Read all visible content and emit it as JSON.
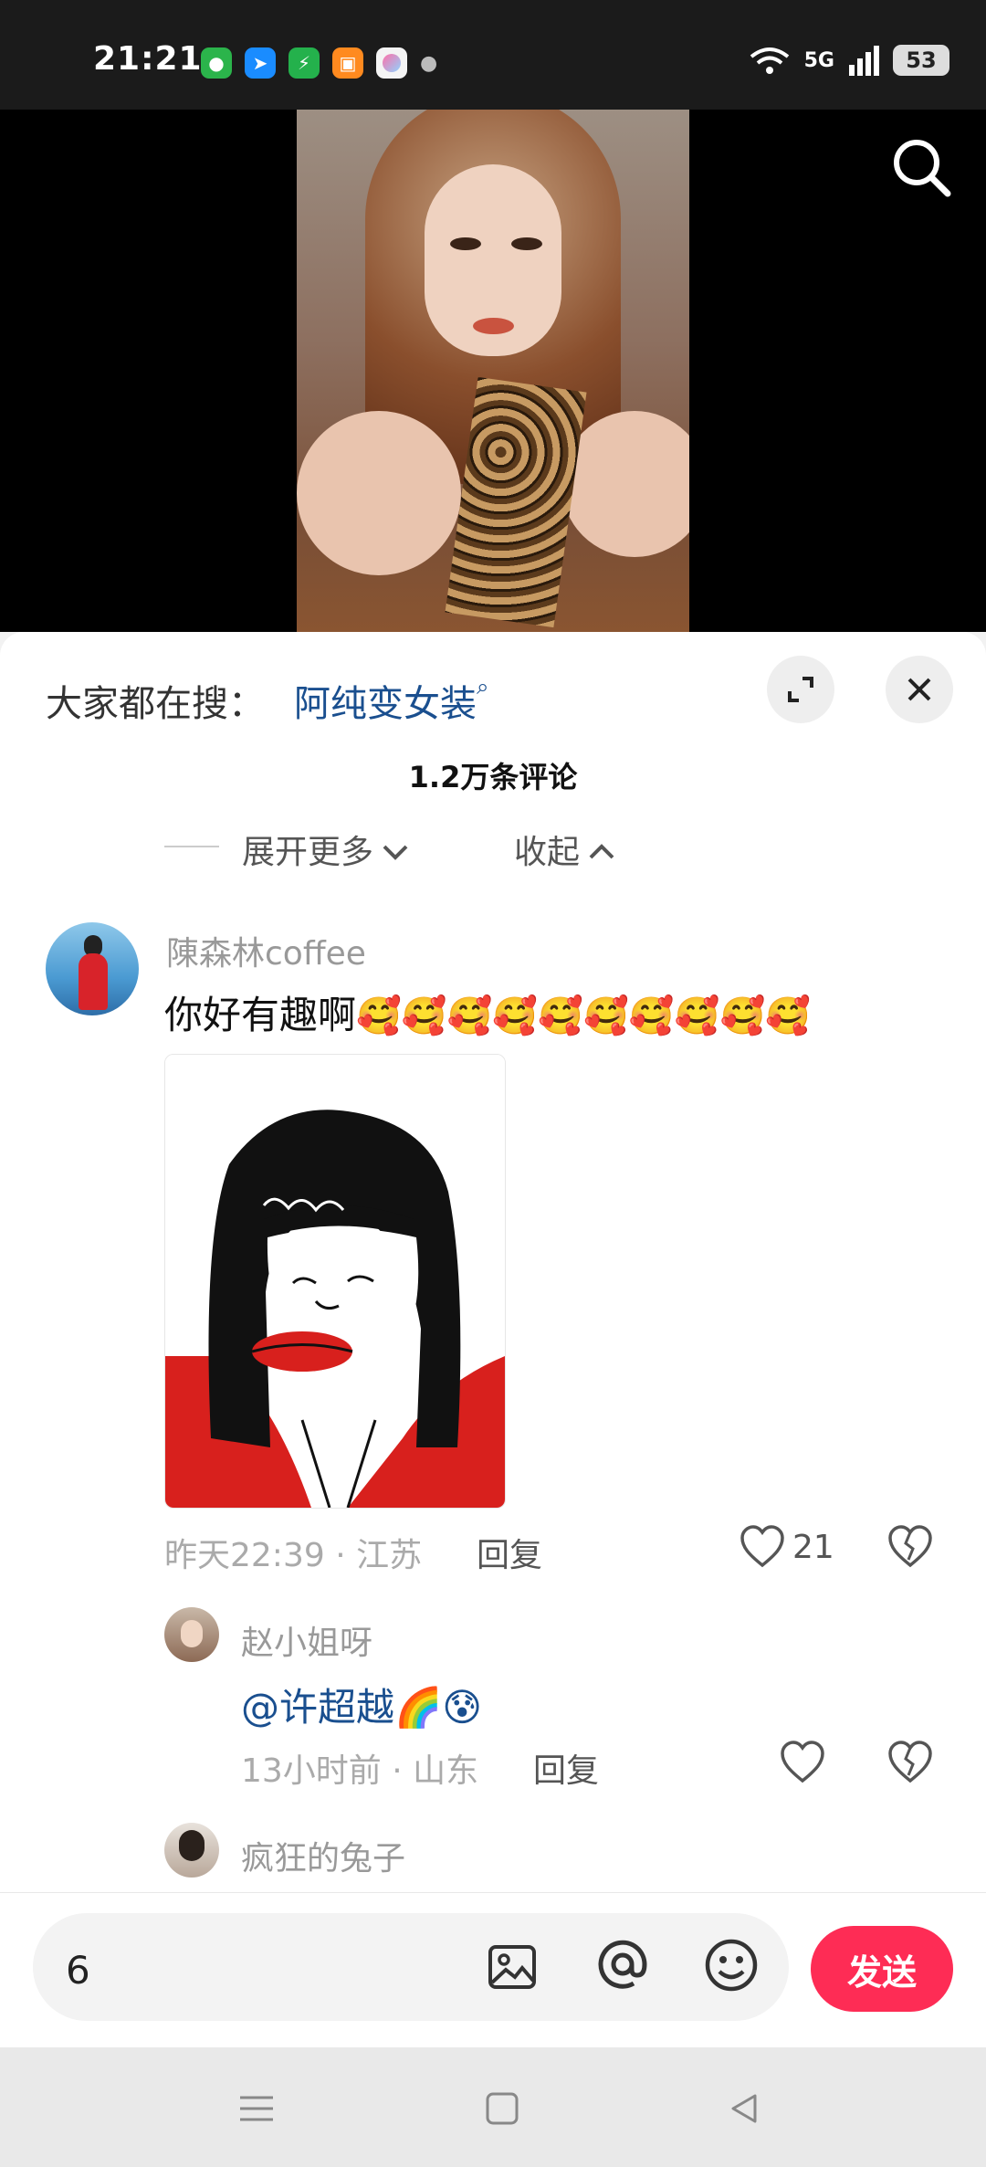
{
  "status_bar": {
    "time": "21:21",
    "network": "5G",
    "battery": "53",
    "apps": [
      "wechat-icon",
      "messenger-icon",
      "security-icon",
      "files-icon",
      "gallery-icon"
    ]
  },
  "hot_search": {
    "prefix": "大家都在搜：",
    "term": "阿纯变女装"
  },
  "comments_header": {
    "count": "1.2万条评论",
    "expand_more": "展开更多",
    "collapse": "收起"
  },
  "comments": [
    {
      "username": "陳森林coffee",
      "text": "你好有趣啊",
      "emoji": "🥰🥰🥰🥰🥰🥰🥰🥰🥰🥰",
      "time": "昨天22:39 · 江苏",
      "reply": "回复",
      "likes": "21"
    }
  ],
  "replies": [
    {
      "username": "赵小姐呀",
      "text": "@许超越🌈😰",
      "time": "13小时前 · 山东",
      "reply": "回复"
    },
    {
      "username": "疯狂的兔子"
    }
  ],
  "input": {
    "value": "6",
    "send_label": "发送"
  },
  "colors": {
    "accent": "#fe2c55",
    "link": "#1a4f8f"
  }
}
